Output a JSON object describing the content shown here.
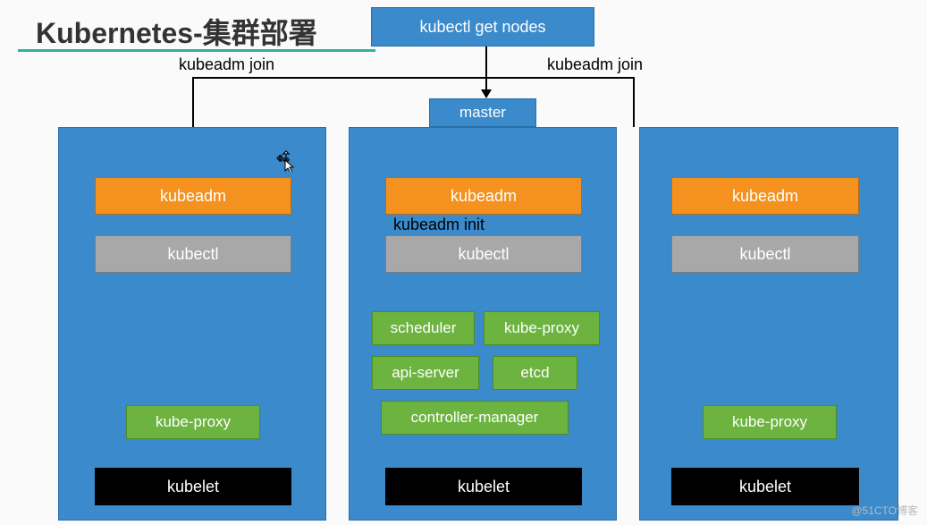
{
  "title": "Kubernetes-集群部署",
  "top_command": "kubectl get nodes",
  "join_label_left": "kubeadm join",
  "join_label_right": "kubeadm join",
  "master_tab": "master",
  "kubeadm_init": "kubeadm init",
  "nodes": {
    "left": {
      "kubeadm": "kubeadm",
      "kubectl": "kubectl",
      "kube_proxy": "kube-proxy",
      "kubelet": "kubelet"
    },
    "mid": {
      "kubeadm": "kubeadm",
      "kubectl": "kubectl",
      "scheduler": "scheduler",
      "kube_proxy": "kube-proxy",
      "api_server": "api-server",
      "etcd": "etcd",
      "controller_manager": "controller-manager",
      "kubelet": "kubelet"
    },
    "right": {
      "kubeadm": "kubeadm",
      "kubectl": "kubectl",
      "kube_proxy": "kube-proxy",
      "kubelet": "kubelet"
    }
  },
  "watermark": "@51CTO博客"
}
